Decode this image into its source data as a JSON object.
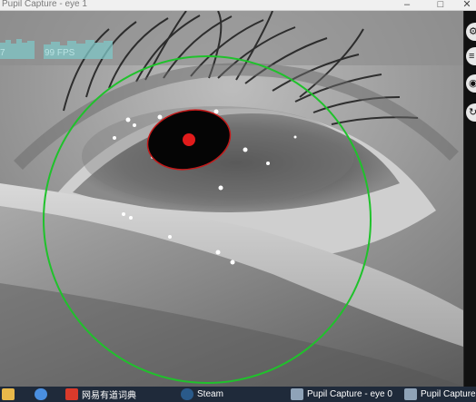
{
  "window": {
    "title": "Pupil Capture - eye 1",
    "controls": [
      "–",
      "□",
      "✕"
    ]
  },
  "overlay": {
    "fps_label": "99 FPS",
    "left_label": "7"
  },
  "sidebar": {
    "icons": [
      "settings-icon",
      "menu-icon",
      "camera-icon",
      "refresh-icon"
    ]
  },
  "taskbar": {
    "items": [
      {
        "label": "",
        "icon": "folder-icon"
      },
      {
        "label": "",
        "icon": "browser-icon"
      },
      {
        "label": "网易有道词典",
        "icon": "youdao-icon"
      },
      {
        "label": "Steam",
        "icon": "steam-icon"
      },
      {
        "label": "Pupil Capture - eye 0",
        "icon": "pupil-window-icon"
      },
      {
        "label": "Pupil Capture",
        "icon": "pupil-window-icon"
      }
    ]
  },
  "colors": {
    "detection_circle": "#1fc22b",
    "pupil_ellipse": "#c41a1a",
    "pupil_center": "#e11b1b",
    "taskbar": "#1f2a3a"
  }
}
